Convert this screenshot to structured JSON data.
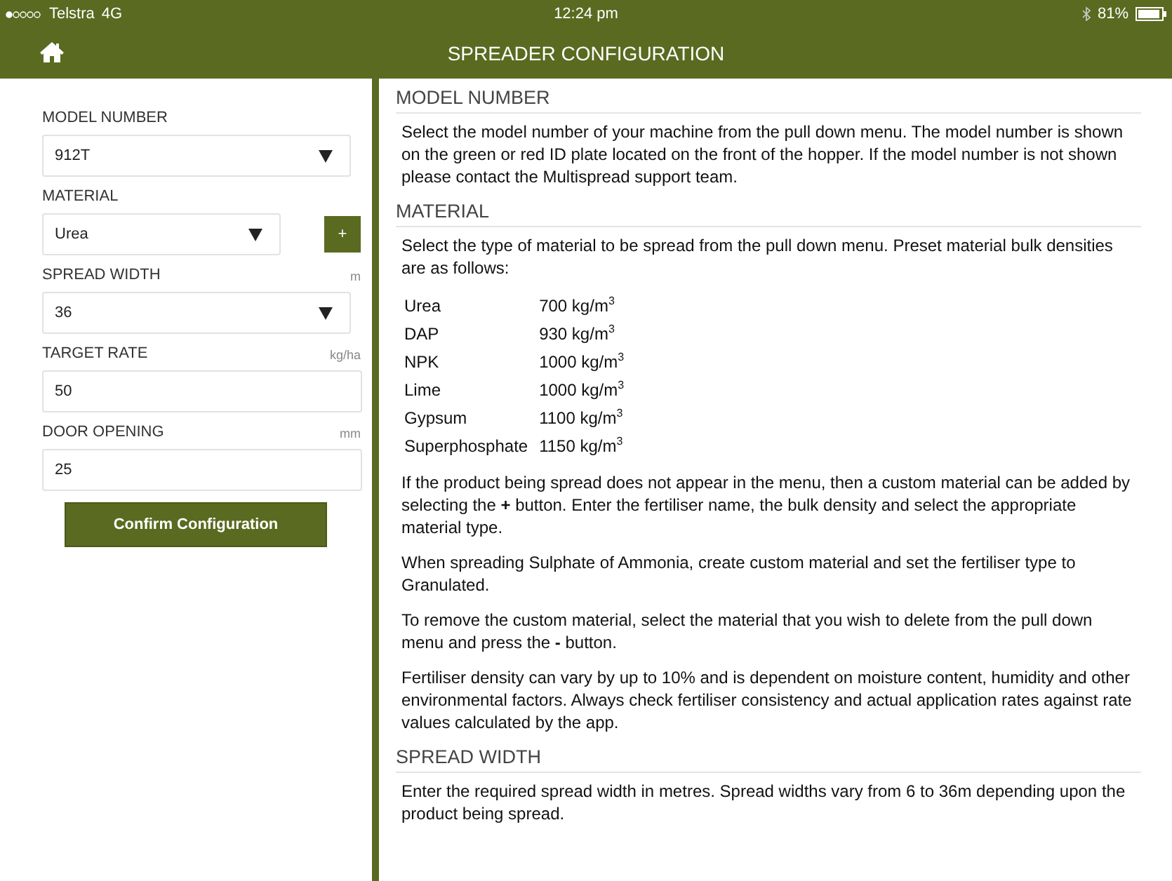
{
  "status_bar": {
    "carrier": "Telstra",
    "network": "4G",
    "time": "12:24 pm",
    "battery": "81%"
  },
  "nav_bar": {
    "title": "SPREADER CONFIGURATION"
  },
  "form": {
    "fields": [
      {
        "kind": "select",
        "label": "MODEL NUMBER",
        "value": "912T"
      },
      {
        "kind": "select_add",
        "label": "MATERIAL",
        "value": "Urea",
        "add_label": "+"
      },
      {
        "kind": "select",
        "label": "SPREAD WIDTH",
        "unit": "m",
        "value": "36"
      },
      {
        "kind": "input",
        "label": "TARGET RATE",
        "unit": "kg/ha",
        "value": "50"
      },
      {
        "kind": "input",
        "label": "DOOR OPENING",
        "unit": "mm",
        "value": "25"
      }
    ],
    "confirm_button": "Confirm Configuration"
  },
  "help": {
    "sections": [
      {
        "heading": "MODEL NUMBER",
        "blocks": [
          {
            "kind": "paragraph",
            "text": "Select the model number of your machine from the pull down menu. The model number is shown on the green or red ID plate located on the front of the hopper. If the model number is not shown please contact the Multispread support team."
          }
        ]
      },
      {
        "heading": "MATERIAL",
        "blocks": [
          {
            "kind": "paragraph",
            "text": "Select the type of material to be spread from the pull down menu. Preset material bulk densities are as follows:"
          },
          {
            "kind": "table",
            "rows": [
              {
                "material": "Urea",
                "density": "700 kg/m$^{3}$"
              },
              {
                "material": "DAP",
                "density": "930 kg/m$^{3}$"
              },
              {
                "material": "NPK",
                "density": "1000 kg/m$^{3}$"
              },
              {
                "material": "Lime",
                "density": "1000 kg/m$^{3}$"
              },
              {
                "material": "Gypsum",
                "density": "1100 kg/m$^{3}$"
              },
              {
                "material": "Superphosphate",
                "density": "1150 kg/m$^{3}$"
              }
            ]
          },
          {
            "kind": "paragraph",
            "text": "If the product being spread does not appear in the menu, then a custom material can be added by selecting the **+** button. Enter the fertiliser name, the bulk density and select the appropriate material type."
          },
          {
            "kind": "paragraph",
            "text": "When spreading Sulphate of Ammonia, create custom material and set the fertiliser type to Granulated."
          },
          {
            "kind": "paragraph",
            "text": "To remove the custom material, select the material that you wish to delete from the pull down menu and press the **-** button."
          },
          {
            "kind": "paragraph",
            "text": "Fertiliser density can vary by up to 10% and is dependent on moisture content, humidity and other environmental factors. Always check fertiliser consistency and actual application rates against rate values calculated by the app."
          }
        ]
      },
      {
        "heading": "SPREAD WIDTH",
        "blocks": [
          {
            "kind": "paragraph",
            "text": "Enter the required spread width in metres. Spread widths vary from 6 to 36m depending upon the product being spread."
          }
        ]
      }
    ]
  }
}
